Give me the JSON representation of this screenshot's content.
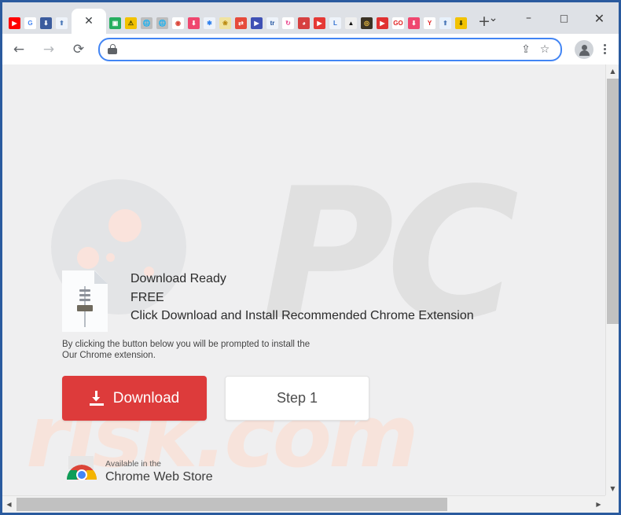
{
  "window": {
    "controls": {
      "tab_search": "⌄",
      "minimize": "–",
      "maximize": "□",
      "close": "✕"
    }
  },
  "tabstrip": {
    "active_tab": {
      "close_label": "✕"
    },
    "new_tab_label": "+",
    "tabs": [
      {
        "name": "youtube",
        "glyph": "▶",
        "bg": "#ff0000",
        "fg": "#ffffff"
      },
      {
        "name": "google",
        "glyph": "G",
        "bg": "#ffffff",
        "fg": "#4285f4"
      },
      {
        "name": "downloader-blue",
        "glyph": "⬇",
        "bg": "#3b5c9e",
        "fg": "#ffffff"
      },
      {
        "name": "cloud-upload",
        "glyph": "⬆",
        "bg": "#eef3fa",
        "fg": "#4a78b8"
      },
      {
        "name": "green-frame",
        "glyph": "▣",
        "bg": "#27ae60",
        "fg": "#ffffff"
      },
      {
        "name": "warning",
        "glyph": "⚠",
        "bg": "#f2c200",
        "fg": "#3a3a00"
      },
      {
        "name": "globe-gray-1",
        "glyph": "🌐",
        "bg": "#bdbdbd",
        "fg": "#ffffff"
      },
      {
        "name": "globe-gray-2",
        "glyph": "🌐",
        "bg": "#bdbdbd",
        "fg": "#ffffff"
      },
      {
        "name": "chrome",
        "glyph": "◉",
        "bg": "#ffffff",
        "fg": "#db4437"
      },
      {
        "name": "download-pink",
        "glyph": "⬇",
        "bg": "#ef476f",
        "fg": "#ffffff"
      },
      {
        "name": "gear-blue",
        "glyph": "✱",
        "bg": "#eef3fa",
        "fg": "#2f80ed"
      },
      {
        "name": "yellow-paws",
        "glyph": "❀",
        "bg": "#f0e3a0",
        "fg": "#b8860b"
      },
      {
        "name": "convert-red",
        "glyph": "⇄",
        "bg": "#e64a3b",
        "fg": "#ffffff"
      },
      {
        "name": "video-blue",
        "glyph": "▶",
        "bg": "#3f51b5",
        "fg": "#ffffff"
      },
      {
        "name": "tr-blue",
        "glyph": "tr",
        "bg": "#eef3fa",
        "fg": "#1a4f9c"
      },
      {
        "name": "sync-pink",
        "glyph": "↻",
        "bg": "#ffffff",
        "fg": "#e9408a"
      },
      {
        "name": "swirl-red",
        "glyph": "◕",
        "bg": "#d64040",
        "fg": "#ffffff"
      },
      {
        "name": "video-red",
        "glyph": "▶",
        "bg": "#e53935",
        "fg": "#ffffff"
      },
      {
        "name": "l-blue",
        "glyph": "L",
        "bg": "#eef3fa",
        "fg": "#2f6fd0"
      },
      {
        "name": "triangle-black",
        "glyph": "▲",
        "bg": "#efefef",
        "fg": "#111111"
      },
      {
        "name": "target-dark",
        "glyph": "◎",
        "bg": "#3b3324",
        "fg": "#f0c040"
      },
      {
        "name": "play-red",
        "glyph": "▶",
        "bg": "#e03131",
        "fg": "#ffffff"
      },
      {
        "name": "go-red",
        "glyph": "GO",
        "bg": "#ffffff",
        "fg": "#e02020"
      },
      {
        "name": "download-red",
        "glyph": "⬇",
        "bg": "#ef476f",
        "fg": "#ffffff"
      },
      {
        "name": "ym-red",
        "glyph": "Y",
        "bg": "#ffffff",
        "fg": "#e02020"
      },
      {
        "name": "cloud-blue",
        "glyph": "⬆",
        "bg": "#e8f1fb",
        "fg": "#4a78b8"
      },
      {
        "name": "download-yellow",
        "glyph": "⬇",
        "bg": "#f2c200",
        "fg": "#3a3a00"
      }
    ]
  },
  "toolbar": {
    "back_label": "←",
    "forward_label": "→",
    "reload_label": "⟳",
    "address": {
      "value": "",
      "placeholder": ""
    },
    "share_label": "⇪",
    "bookmark_label": "☆",
    "security_icon": "lock-icon"
  },
  "page": {
    "watermark_top": "PC",
    "watermark_bottom": "risk.com",
    "headline": "Download Ready",
    "free_label": "FREE",
    "instruction": "Click Download and Install Recommended Chrome Extension",
    "fine_print_line1": "By clicking the button below you will be prompted to install the",
    "fine_print_line2": "Our Chrome extension.",
    "download_button": "Download",
    "step_button": "Step 1",
    "webstore": {
      "line1": "Available in the",
      "line2": "Chrome Web Store"
    }
  },
  "colors": {
    "download_button_bg": "#dd3b3b",
    "omnibox_border": "#4285f4",
    "window_border": "#2a5a9e",
    "page_bg": "#efeff0",
    "watermark_top": "#e0e0e0",
    "watermark_bottom": "#f7e3db"
  },
  "scrollbars": {
    "v_up": "▲",
    "v_down": "▼",
    "h_left": "◀",
    "h_right": "▶"
  }
}
